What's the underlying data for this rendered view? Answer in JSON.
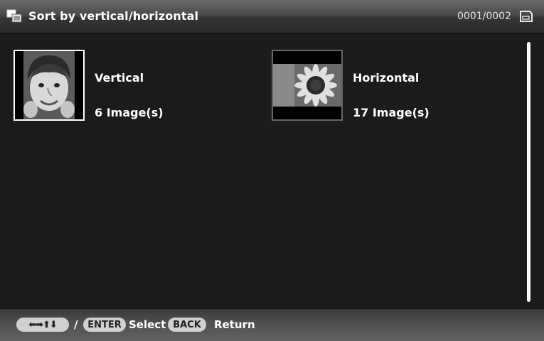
{
  "header": {
    "app_icon": "stacked-photos-icon",
    "title": "Sort by vertical/horizontal",
    "page_counter": "0001/0002",
    "device_icon": "memory-card-icon"
  },
  "groups": [
    {
      "label": "Vertical",
      "count": "6 Image(s)",
      "thumbnail": "boy-portrait-thumbnail",
      "selected": true
    },
    {
      "label": "Horizontal",
      "count": "17 Image(s)",
      "thumbnail": "sunflower-thumbnail",
      "selected": false
    }
  ],
  "footer": {
    "arrows": "⬅➡⬆⬇",
    "slash": "/",
    "enter_key": "ENTER",
    "select_label": "Select",
    "back_key": "BACK",
    "return_label": "Return"
  },
  "colors": {
    "background": "#1b1b1b",
    "text": "#ffffff",
    "selected_border": "#ffffff",
    "unselected_border": "#666666",
    "key_pill": "#d0d0d0"
  }
}
